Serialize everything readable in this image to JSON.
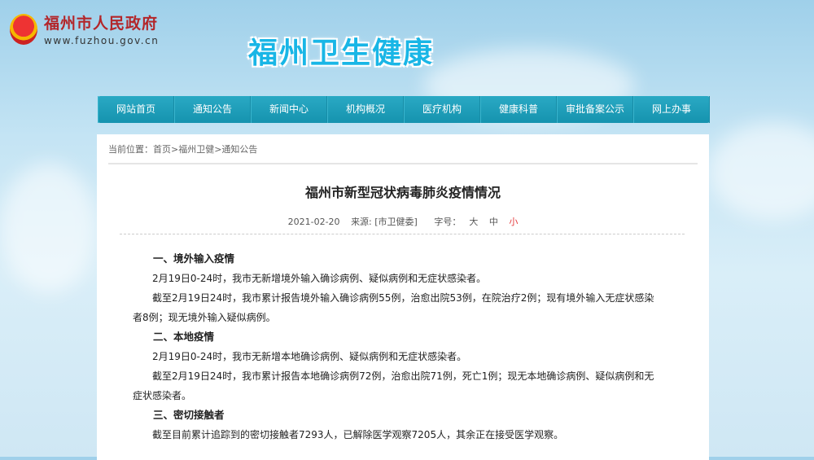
{
  "header": {
    "gov_name": "福州市人民政府",
    "gov_url": "www.fuzhou.gov.cn",
    "site_title": "福州卫生健康"
  },
  "nav": [
    "网站首页",
    "通知公告",
    "新闻中心",
    "机构概况",
    "医疗机构",
    "健康科普",
    "审批备案公示",
    "网上办事"
  ],
  "breadcrumb": "当前位置：首页>福州卫健>通知公告",
  "article": {
    "title": "福州市新型冠状病毒肺炎疫情情况",
    "date": "2021-02-20",
    "source": "来源: [市卫健委]",
    "font_label": "字号：",
    "font_large": "大",
    "font_medium": "中",
    "font_small": "小",
    "sections": [
      {
        "heading": "一、境外输入疫情",
        "paragraphs": [
          "2月19日0-24时，我市无新增境外输入确诊病例、疑似病例和无症状感染者。",
          "截至2月19日24时，我市累计报告境外输入确诊病例55例，治愈出院53例，在院治疗2例；现有境外输入无症状感染者8例；现无境外输入疑似病例。"
        ]
      },
      {
        "heading": "二、本地疫情",
        "paragraphs": [
          "2月19日0-24时，我市无新增本地确诊病例、疑似病例和无症状感染者。",
          "截至2月19日24时，我市累计报告本地确诊病例72例，治愈出院71例，死亡1例；现无本地确诊病例、疑似病例和无症状感染者。"
        ]
      },
      {
        "heading": "三、密切接触者",
        "paragraphs": [
          "截至目前累计追踪到的密切接触者7293人，已解除医学观察7205人，其余正在接受医学观察。"
        ]
      }
    ]
  }
}
